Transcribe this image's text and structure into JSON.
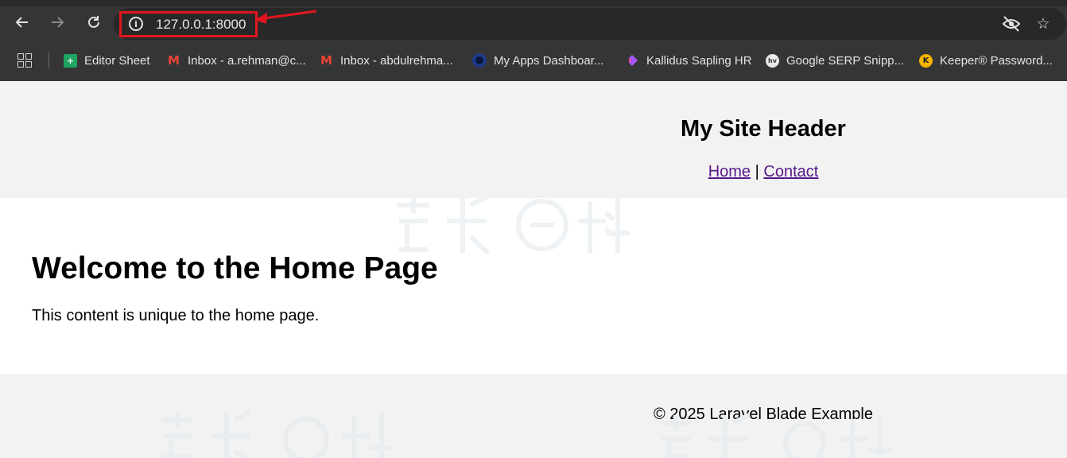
{
  "browser": {
    "nav": {
      "back_icon": "arrow-left-icon",
      "forward_icon": "arrow-right-icon",
      "reload_icon": "reload-icon"
    },
    "address_bar": {
      "url": "127.0.0.1:8000",
      "site_info_icon": "info-icon",
      "highlight_color": "#e0161f"
    },
    "right_icons": [
      "eye-off-icon",
      "star-icon"
    ],
    "bookmarks": [
      {
        "label": "Editor Sheet",
        "icon": "google-sheets-icon"
      },
      {
        "label": "Inbox - a.rehman@c...",
        "icon": "gmail-icon"
      },
      {
        "label": "Inbox - abdulrehma...",
        "icon": "gmail-icon"
      },
      {
        "label": "My Apps Dashboar...",
        "icon": "apps-dashboard-icon"
      },
      {
        "label": "Kallidus Sapling HR",
        "icon": "kallidus-icon"
      },
      {
        "label": "Google SERP Snipp...",
        "icon": "serp-snippet-icon"
      },
      {
        "label": "Keeper® Password...",
        "icon": "keeper-icon"
      }
    ]
  },
  "page": {
    "header": {
      "title": "My Site Header",
      "nav_home": "Home",
      "nav_separator": "|",
      "nav_contact": "Contact"
    },
    "main": {
      "title": "Welcome to the Home Page",
      "text": "This content is unique to the home page."
    },
    "footer": {
      "text": "© 2025 Laravel Blade Example"
    }
  },
  "colors": {
    "chrome_bg": "#353535",
    "omnibox_bg": "#282828",
    "page_section_bg": "#f2f2f2",
    "link": "#551a8b"
  }
}
